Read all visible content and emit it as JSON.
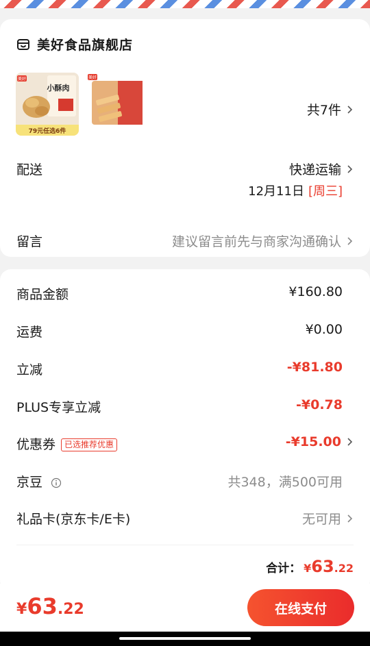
{
  "colors": {
    "accent": "#e93b2c",
    "muted": "#8c8c8c",
    "button_start": "#f5532f",
    "button_end": "#ea2c2c"
  },
  "shop": {
    "name": "美好食品旗舰店",
    "icon": "store-icon",
    "item1_brand": "美好",
    "item1_title": "小酥肉",
    "item1_promo": "79元任选6件",
    "item2_brand": "美好",
    "item_count": "共7件"
  },
  "delivery": {
    "label": "配送",
    "method": "快递运输",
    "date": "12月11日",
    "weekday": "[周三]"
  },
  "message": {
    "label": "留言",
    "placeholder": "建议留言前先与商家沟通确认"
  },
  "price_rows": {
    "goods_label": "商品金额",
    "goods_value": "¥160.80",
    "freight_label": "运费",
    "freight_value": "¥0.00",
    "discount_label": "立减",
    "discount_value": "-¥81.80",
    "plus_label": "PLUS专享立减",
    "plus_value": "-¥0.78",
    "coupon_label": "优惠券",
    "coupon_tag": "已选推荐优惠",
    "coupon_value": "-¥15.00",
    "jingdou_label": "京豆",
    "jingdou_value": "共348，满500可用",
    "giftcard_label": "礼品卡(京东卡/E卡)",
    "giftcard_value": "无可用"
  },
  "total": {
    "label": "合计：",
    "symbol": "¥",
    "integer": "63",
    "decimal": ".22"
  },
  "bottom": {
    "symbol": "¥",
    "integer": "63",
    "decimal": ".22",
    "pay_label": "在线支付"
  }
}
